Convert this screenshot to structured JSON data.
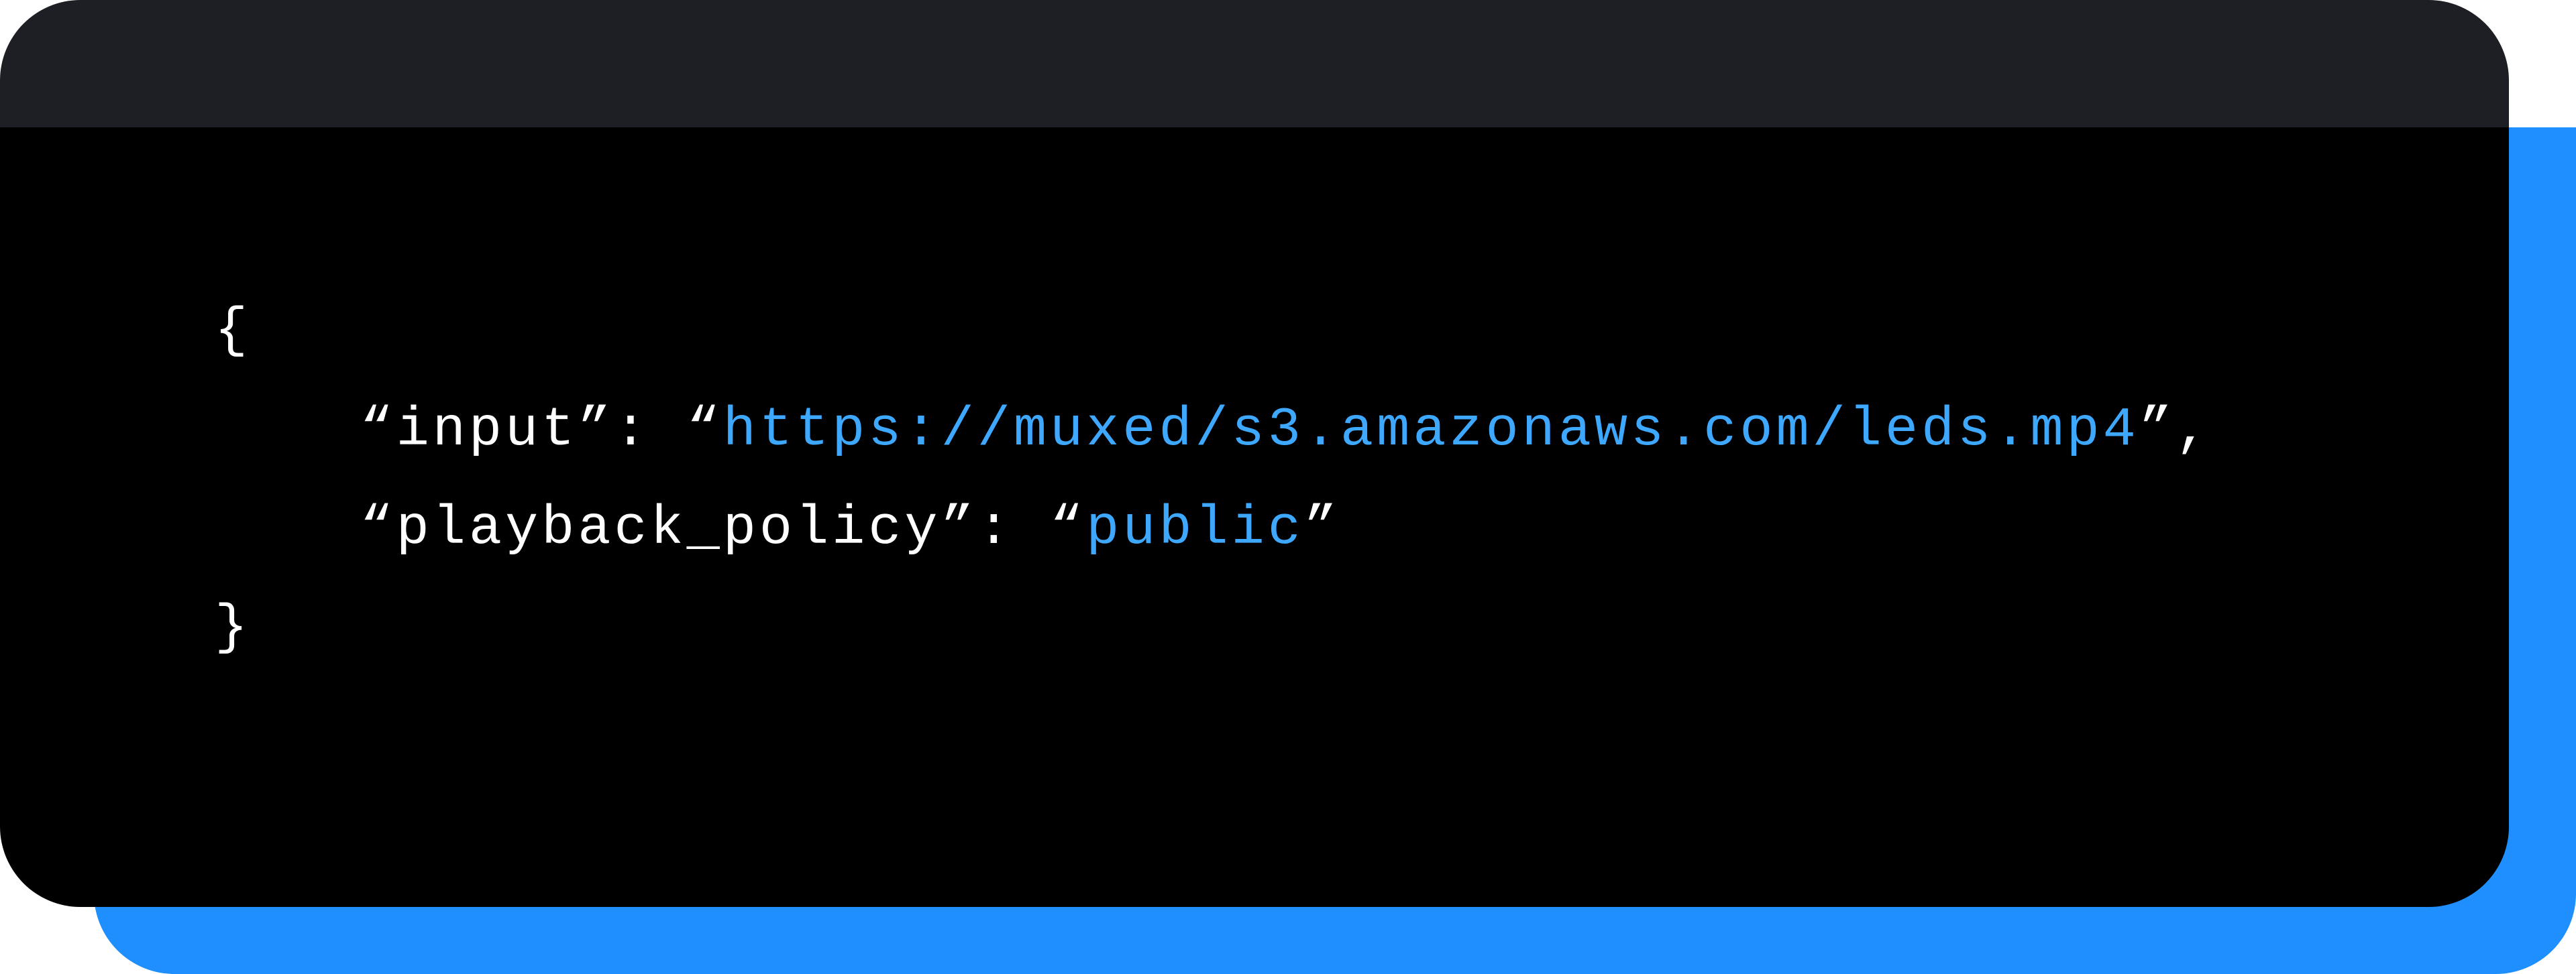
{
  "code": {
    "line1_open": "{",
    "line2_keyprefix": "    “input”: “",
    "line2_value": "https://muxed/s3.amazonaws.com/leds.mp4",
    "line2_suffix": "”,",
    "line3_keyprefix": "    “playback_policy”: “",
    "line3_value": "public",
    "line3_suffix": "”",
    "line4_close": "}"
  },
  "colors": {
    "accent_backdrop": "#1f8fff",
    "header_bar": "#1d1f25",
    "code_bg": "#000000",
    "code_value": "#3ea8ff"
  }
}
